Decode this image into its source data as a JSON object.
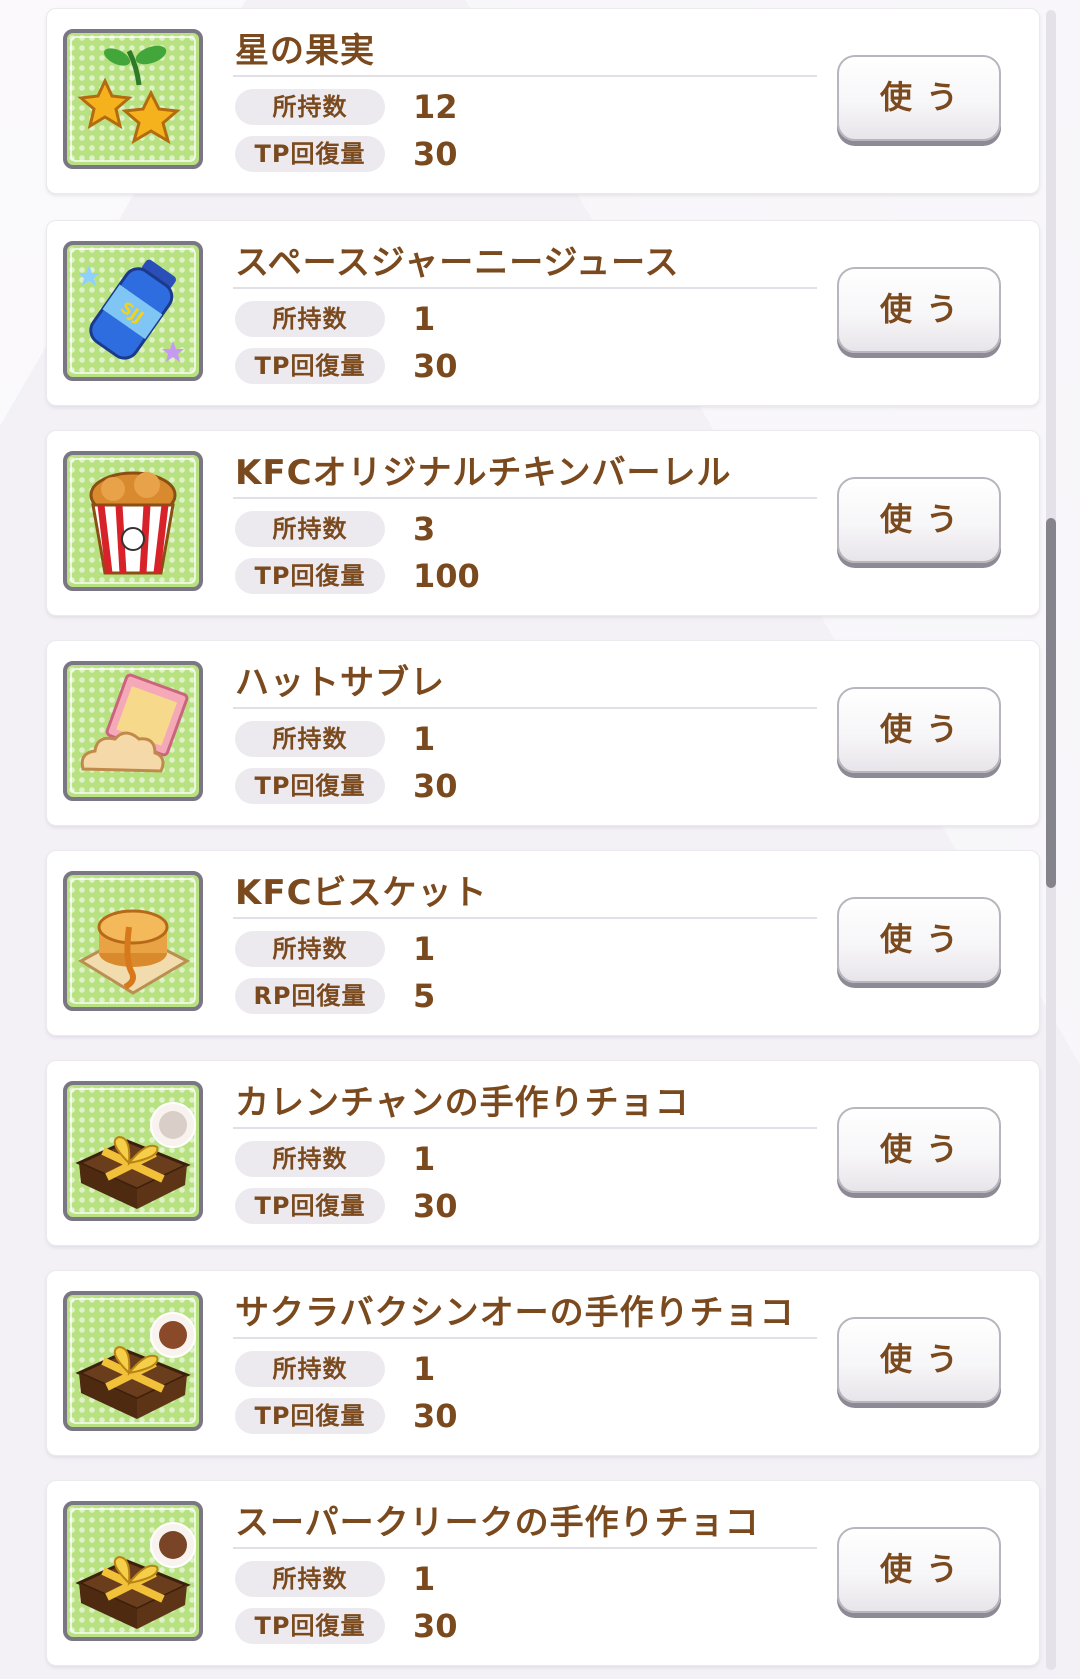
{
  "stat_labels": {
    "owned": "所持数",
    "tp": "TP回復量",
    "rp": "RP回復量"
  },
  "use_label": "使う",
  "items": [
    {
      "name": "星の果実",
      "owned": "12",
      "recovery_label": "TP回復量",
      "recovery": "30",
      "icon": "star-fruit-icon"
    },
    {
      "name": "スペースジャーニージュース",
      "owned": "1",
      "recovery_label": "TP回復量",
      "recovery": "30",
      "icon": "juice-bottle-icon"
    },
    {
      "name": "KFCオリジナルチキンバーレル",
      "owned": "3",
      "recovery_label": "TP回復量",
      "recovery": "100",
      "icon": "chicken-bucket-icon"
    },
    {
      "name": "ハットサブレ",
      "owned": "1",
      "recovery_label": "TP回復量",
      "recovery": "30",
      "icon": "cookie-icon"
    },
    {
      "name": "KFCビスケット",
      "owned": "1",
      "recovery_label": "RP回復量",
      "recovery": "5",
      "icon": "biscuit-icon"
    },
    {
      "name": "カレンチャンの手作りチョコ",
      "owned": "1",
      "recovery_label": "TP回復量",
      "recovery": "30",
      "icon": "gift-box-icon"
    },
    {
      "name": "サクラバクシンオーの手作りチョコ",
      "owned": "1",
      "recovery_label": "TP回復量",
      "recovery": "30",
      "icon": "gift-box-icon"
    },
    {
      "name": "スーパークリークの手作りチョコ",
      "owned": "1",
      "recovery_label": "TP回復量",
      "recovery": "30",
      "icon": "gift-box-icon"
    }
  ],
  "colors": {
    "text_brown": "#7a4a1e",
    "thumb_green": "#b8e282",
    "thumb_border": "#7a7684"
  }
}
